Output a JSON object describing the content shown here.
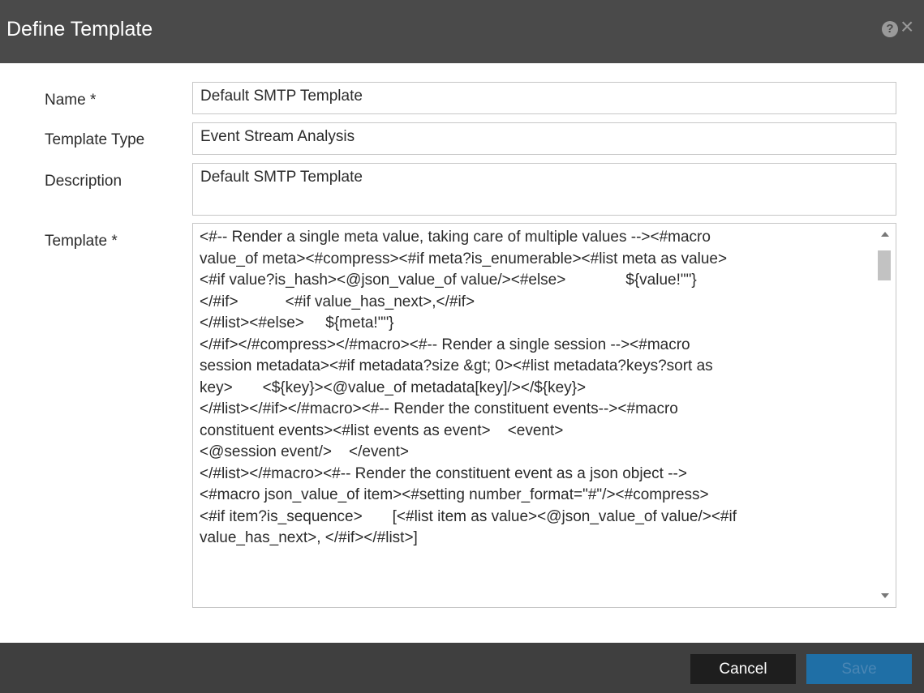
{
  "dialog": {
    "title": "Define Template",
    "help_icon": "help-icon",
    "close_icon": "close-icon"
  },
  "form": {
    "name_label": "Name *",
    "name_value": "Default SMTP Template",
    "type_label": "Template Type",
    "type_value": "Event Stream Analysis",
    "description_label": "Description",
    "description_value": "Default SMTP Template",
    "template_label": "Template *",
    "template_lines": [
      "<#-- Render a single meta value, taking care of multiple values --><#macro",
      "value_of meta><#compress><#if meta?is_enumerable><#list meta as value>",
      "<#if value?is_hash><@json_value_of value/><#else>              ${value!\"\"}",
      "</#if>           <#if value_has_next>,</#if>",
      "</#list><#else>     ${meta!\"\"}",
      "</#if></#compress></#macro><#-- Render a single session --><#macro",
      "session metadata><#if metadata?size &gt; 0><#list metadata?keys?sort as",
      "key>       <${key}><@value_of metadata[key]/></${key}>",
      "</#list></#if></#macro><#-- Render the constituent events--><#macro",
      "constituent events><#list events as event>    <event>",
      "<@session event/>    </event>",
      "</#list></#macro><#-- Render the constituent event as a json object -->",
      "<#macro json_value_of item><#setting number_format=\"#\"/><#compress>",
      "<#if item?is_sequence>       [<#list item as value><@json_value_of value/><#if",
      "value_has_next>, </#if></#list>]"
    ]
  },
  "footer": {
    "cancel_label": "Cancel",
    "save_label": "Save"
  },
  "colors": {
    "titlebar": "#4a4a4a",
    "footer": "#3f3f3f",
    "cancel_button": "#1e1e1e",
    "save_button": "#1f6fa6"
  }
}
